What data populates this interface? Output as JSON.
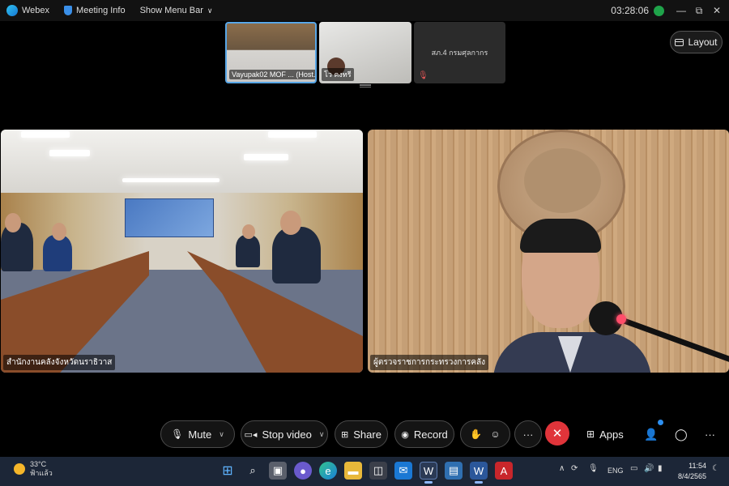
{
  "titlebar": {
    "app_name": "Webex",
    "meeting_info": "Meeting Info",
    "show_menu_bar": "Show Menu Bar",
    "caret": "∨",
    "elapsed_time": "03:28:06",
    "minimize": "—",
    "restore": "⧉",
    "close": "✕"
  },
  "thumbnails": [
    {
      "name": "Vayupak02 MOF ... (Host...)"
    },
    {
      "name": "โว คงทรี"
    },
    {
      "name": "สภ.4 กรมศุลกากร"
    }
  ],
  "layout_button": {
    "label": "Layout"
  },
  "videos": {
    "left_label": "สำนักงานคลังจังหวัดนราธิวาส",
    "right_label": "ผู้ตรวจราชการกระทรวงการคลัง"
  },
  "controls": {
    "mute": "Mute",
    "stop_video": "Stop video",
    "share": "Share",
    "record": "Record",
    "more": "···",
    "end": "✕",
    "apps": "Apps",
    "overflow": "···"
  },
  "taskbar": {
    "temperature": "33°C",
    "weather_desc": "ฟ้าแล้ว",
    "language": "ENG",
    "time": "11:54",
    "date": "8/4/2565"
  },
  "colors": {
    "end_call": "#e0343a",
    "active_thumb_border": "#58a6e6",
    "taskbar": "#1c2637"
  }
}
